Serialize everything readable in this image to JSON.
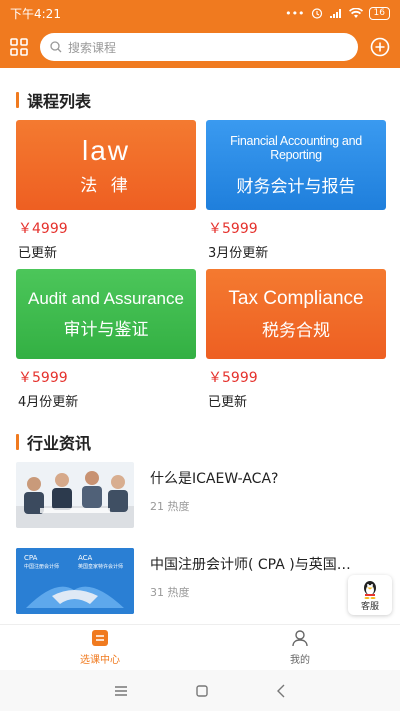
{
  "status": {
    "time": "下午4:21",
    "battery": "16"
  },
  "header": {
    "search_placeholder": "搜索课程"
  },
  "courses_section": {
    "title": "课程列表"
  },
  "courses": [
    {
      "en": "law",
      "zh": "法  律",
      "price": "￥4999",
      "update": "已更新",
      "color": "#f26a27"
    },
    {
      "en": "Financial Accounting and Reporting",
      "zh": "财务会计与报告",
      "price": "￥5999",
      "update": "3月份更新",
      "color": "#2d8de8"
    },
    {
      "en": "Audit and Assurance",
      "zh": "审计与鉴证",
      "price": "￥5999",
      "update": "4月份更新",
      "color": "#3dbb4a"
    },
    {
      "en": "Tax Compliance",
      "zh": "税务合规",
      "price": "￥5999",
      "update": "已更新",
      "color": "#f26a27"
    }
  ],
  "news_section": {
    "title": "行业资讯"
  },
  "news": [
    {
      "title": "什么是ICAEW-ACA?",
      "heat": "21 热度"
    },
    {
      "title": "中国注册会计师( CPA )与英国…",
      "heat": "31 热度"
    }
  ],
  "news_thumb_labels": {
    "cpa": "CPA",
    "cpa_sub": "中国注册会计师",
    "aca": "ACA",
    "aca_sub": "英国皇家特许会计师"
  },
  "service": {
    "label": "客服"
  },
  "bottom_nav": [
    {
      "label": "选课中心",
      "active": true
    },
    {
      "label": "我的",
      "active": false
    }
  ]
}
